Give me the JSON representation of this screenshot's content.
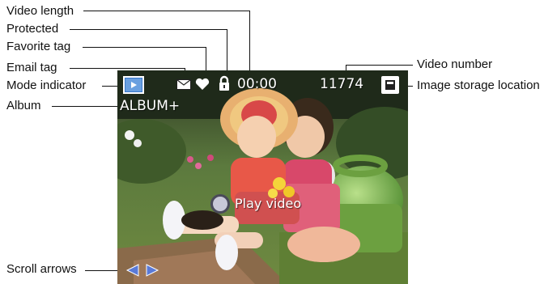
{
  "callouts": {
    "video_length": "Video length",
    "protected": "Protected",
    "favorite_tag": "Favorite tag",
    "email_tag": "Email tag",
    "mode_indicator": "Mode indicator",
    "album": "Album",
    "scroll_arrows": "Scroll arrows",
    "video_number": "Video number",
    "image_storage_location": "Image storage location"
  },
  "screen": {
    "time": "00:00",
    "video_number": "11774",
    "album": "ALBUM+",
    "play_label": "Play video"
  },
  "icons": {
    "mode": "video-mode-icon",
    "email": "envelope-icon",
    "favorite": "heart-icon",
    "protected": "lock-icon",
    "storage": "memory-card-icon",
    "scroll": "triangle-arrow-icons"
  },
  "colors": {
    "overlay_text": "#ffffff",
    "arrow_fill": "#5a7ad8",
    "mode_icon_bg": "#3a78c8"
  }
}
